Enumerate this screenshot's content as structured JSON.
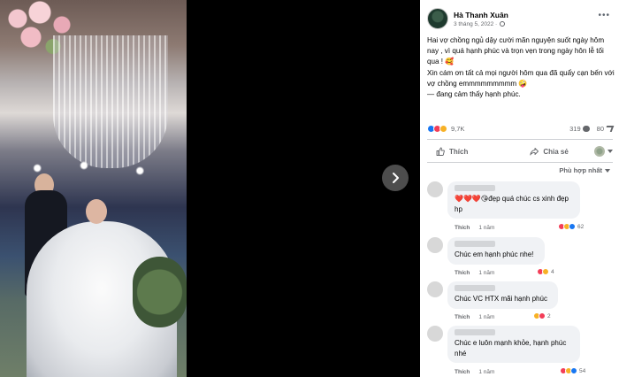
{
  "post": {
    "author": "Hà Thanh Xuân",
    "date": "3 tháng 5, 2022 ·",
    "lines": [
      "Hai vợ chồng ngủ dậy cười mãn nguyện suốt ngày hôm nay , vì quá hạnh phúc và trọn vẹn trong ngày hôn lễ tối qua ! 🥰",
      "Xin cám ơn tất cả mọi người hôm qua đã quẩy cạn bến với vợ chồng emmmmmmmmm 🤪",
      "— đang cảm thấy hạnh phúc."
    ]
  },
  "stats": {
    "reactions": "9,7K",
    "comments": "319",
    "shares": "80"
  },
  "actions": {
    "like": "Thích",
    "share": "Chia sẻ"
  },
  "sort_label": "Phù hợp nhất",
  "comments": [
    {
      "text": "❤️❤️❤️😘đẹp quá chúc cs xinh đẹp hp",
      "like": "Thích",
      "time": "1 năm",
      "reacts": "62"
    },
    {
      "text": "Chúc em hạnh phúc nhe!",
      "like": "Thích",
      "time": "1 năm",
      "reacts": "4"
    },
    {
      "text": "Chúc VC HTX mãi hạnh phúc",
      "like": "Thích",
      "time": "1 năm",
      "reacts": "2"
    },
    {
      "text": "Chúc e luôn mạnh khỏe, hạnh phúc nhé",
      "like": "Thích",
      "time": "1 năm",
      "reacts": "54"
    }
  ],
  "icons": {
    "next": "chevron-right-icon",
    "more": "more-icon",
    "like": "thumb-up-icon",
    "share": "share-arrow-icon"
  },
  "colors": {
    "brand": "#1877f2",
    "love": "#f33e58",
    "haha": "#f7b125",
    "secondary_text": "#65676b"
  }
}
